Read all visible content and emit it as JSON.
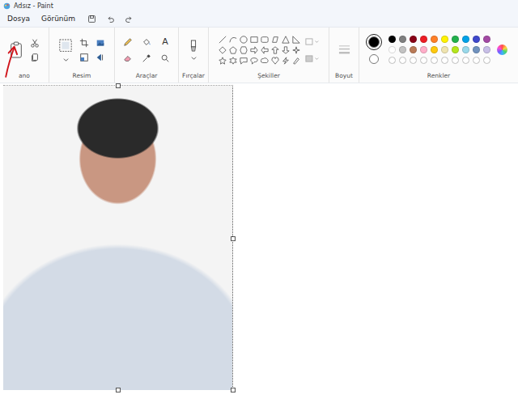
{
  "window": {
    "title": "Adsız - Paint"
  },
  "menu": [
    "Dosya",
    "Görünüm"
  ],
  "ribbon": {
    "clipboard": "ano",
    "image": "Resim",
    "tools": "Araçlar",
    "brushes": "Fırçalar",
    "shapes": "Şekiller",
    "size": "Boyut",
    "colors": "Renkler"
  },
  "text_tool": "A",
  "current_colors": [
    {
      "color": "#000000",
      "selected": true
    },
    {
      "color": "#ffffff",
      "selected": false
    }
  ],
  "palette": [
    {
      "kind": "swatch",
      "color": "#000000",
      "selected": false
    },
    {
      "kind": "swatch",
      "color": "#7f7f7f",
      "selected": false
    },
    {
      "kind": "swatch",
      "color": "#880015",
      "selected": false
    },
    {
      "kind": "swatch",
      "color": "#ed1c24",
      "selected": false
    },
    {
      "kind": "swatch",
      "color": "#ff7f27",
      "selected": false
    },
    {
      "kind": "swatch",
      "color": "#fff200",
      "selected": false
    },
    {
      "kind": "swatch",
      "color": "#22b14c",
      "selected": false
    },
    {
      "kind": "swatch",
      "color": "#00a2e8",
      "selected": false
    },
    {
      "kind": "swatch",
      "color": "#3f48cc",
      "selected": false
    },
    {
      "kind": "swatch",
      "color": "#a349a4",
      "selected": false
    },
    {
      "kind": "swatch",
      "color": "#ffffff",
      "selected": false
    },
    {
      "kind": "swatch",
      "color": "#c3c3c3",
      "selected": false
    },
    {
      "kind": "swatch",
      "color": "#b97a57",
      "selected": false
    },
    {
      "kind": "swatch",
      "color": "#ffaec9",
      "selected": false
    },
    {
      "kind": "swatch",
      "color": "#ffc90e",
      "selected": false
    },
    {
      "kind": "swatch",
      "color": "#efe4b0",
      "selected": false
    },
    {
      "kind": "swatch",
      "color": "#b5e61d",
      "selected": false
    },
    {
      "kind": "swatch",
      "color": "#99d9ea",
      "selected": false
    },
    {
      "kind": "swatch",
      "color": "#7092be",
      "selected": false
    },
    {
      "kind": "swatch",
      "color": "#c8bfe7",
      "selected": false
    },
    {
      "kind": "empty",
      "color": "#ffffff",
      "selected": false
    },
    {
      "kind": "empty",
      "color": "#ffffff",
      "selected": false
    },
    {
      "kind": "empty",
      "color": "#ffffff",
      "selected": false
    },
    {
      "kind": "empty",
      "color": "#ffffff",
      "selected": false
    },
    {
      "kind": "empty",
      "color": "#ffffff",
      "selected": false
    },
    {
      "kind": "empty",
      "color": "#ffffff",
      "selected": false
    },
    {
      "kind": "empty",
      "color": "#ffffff",
      "selected": false
    },
    {
      "kind": "empty",
      "color": "#ffffff",
      "selected": false
    },
    {
      "kind": "empty",
      "color": "#ffffff",
      "selected": false
    },
    {
      "kind": "empty",
      "color": "#ffffff",
      "selected": false
    }
  ]
}
